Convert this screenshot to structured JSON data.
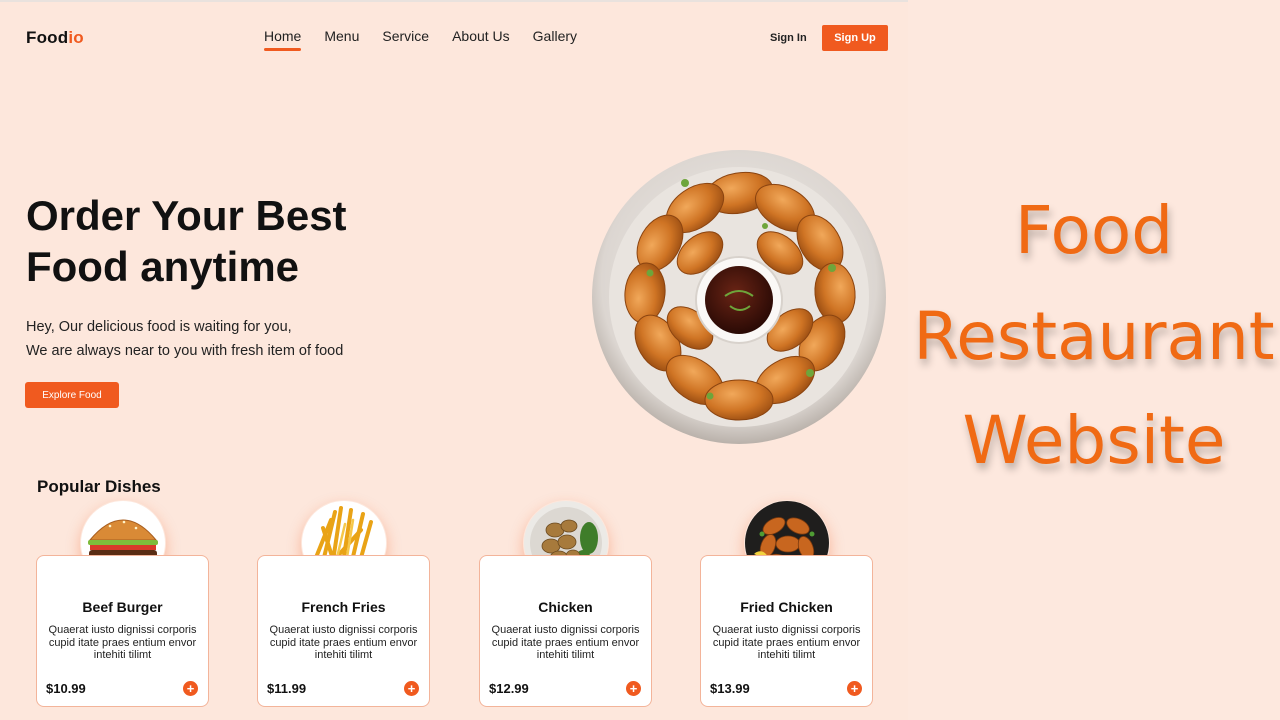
{
  "header": {
    "logo_main": "Food",
    "logo_accent": "io",
    "nav": [
      {
        "label": "Home",
        "active": true
      },
      {
        "label": "Menu",
        "active": false
      },
      {
        "label": "Service",
        "active": false
      },
      {
        "label": "About Us",
        "active": false
      },
      {
        "label": "Gallery",
        "active": false
      }
    ],
    "signin_label": "Sign In",
    "signup_label": "Sign Up"
  },
  "hero": {
    "title_line1": "Order Your Best",
    "title_line2": "Food anytime",
    "sub_line1": "Hey, Our delicious food is waiting for you,",
    "sub_line2": "We are always near to you with fresh item of food",
    "cta_label": "Explore Food"
  },
  "popular": {
    "heading": "Popular Dishes",
    "items": [
      {
        "name": "Beef Burger",
        "desc": "Quaerat iusto dignissi corporis cupid itate praes entium envor intehiti tilimt",
        "price": "$10.99"
      },
      {
        "name": "French Fries",
        "desc": "Quaerat iusto dignissi corporis cupid itate praes entium envor intehiti tilimt",
        "price": "$11.99"
      },
      {
        "name": "Chicken",
        "desc": "Quaerat iusto dignissi corporis cupid itate praes entium envor intehiti tilimt",
        "price": "$12.99"
      },
      {
        "name": "Fried Chicken",
        "desc": "Quaerat iusto dignissi corporis cupid itate praes entium envor intehiti tilimt",
        "price": "$13.99"
      }
    ],
    "add_symbol": "+"
  },
  "overlay": {
    "line1": "Food",
    "line2": "Restaurant",
    "line3": "Website"
  },
  "colors": {
    "accent": "#f05a1f",
    "background": "#fde7dc",
    "overlay_text": "#f06a14"
  }
}
